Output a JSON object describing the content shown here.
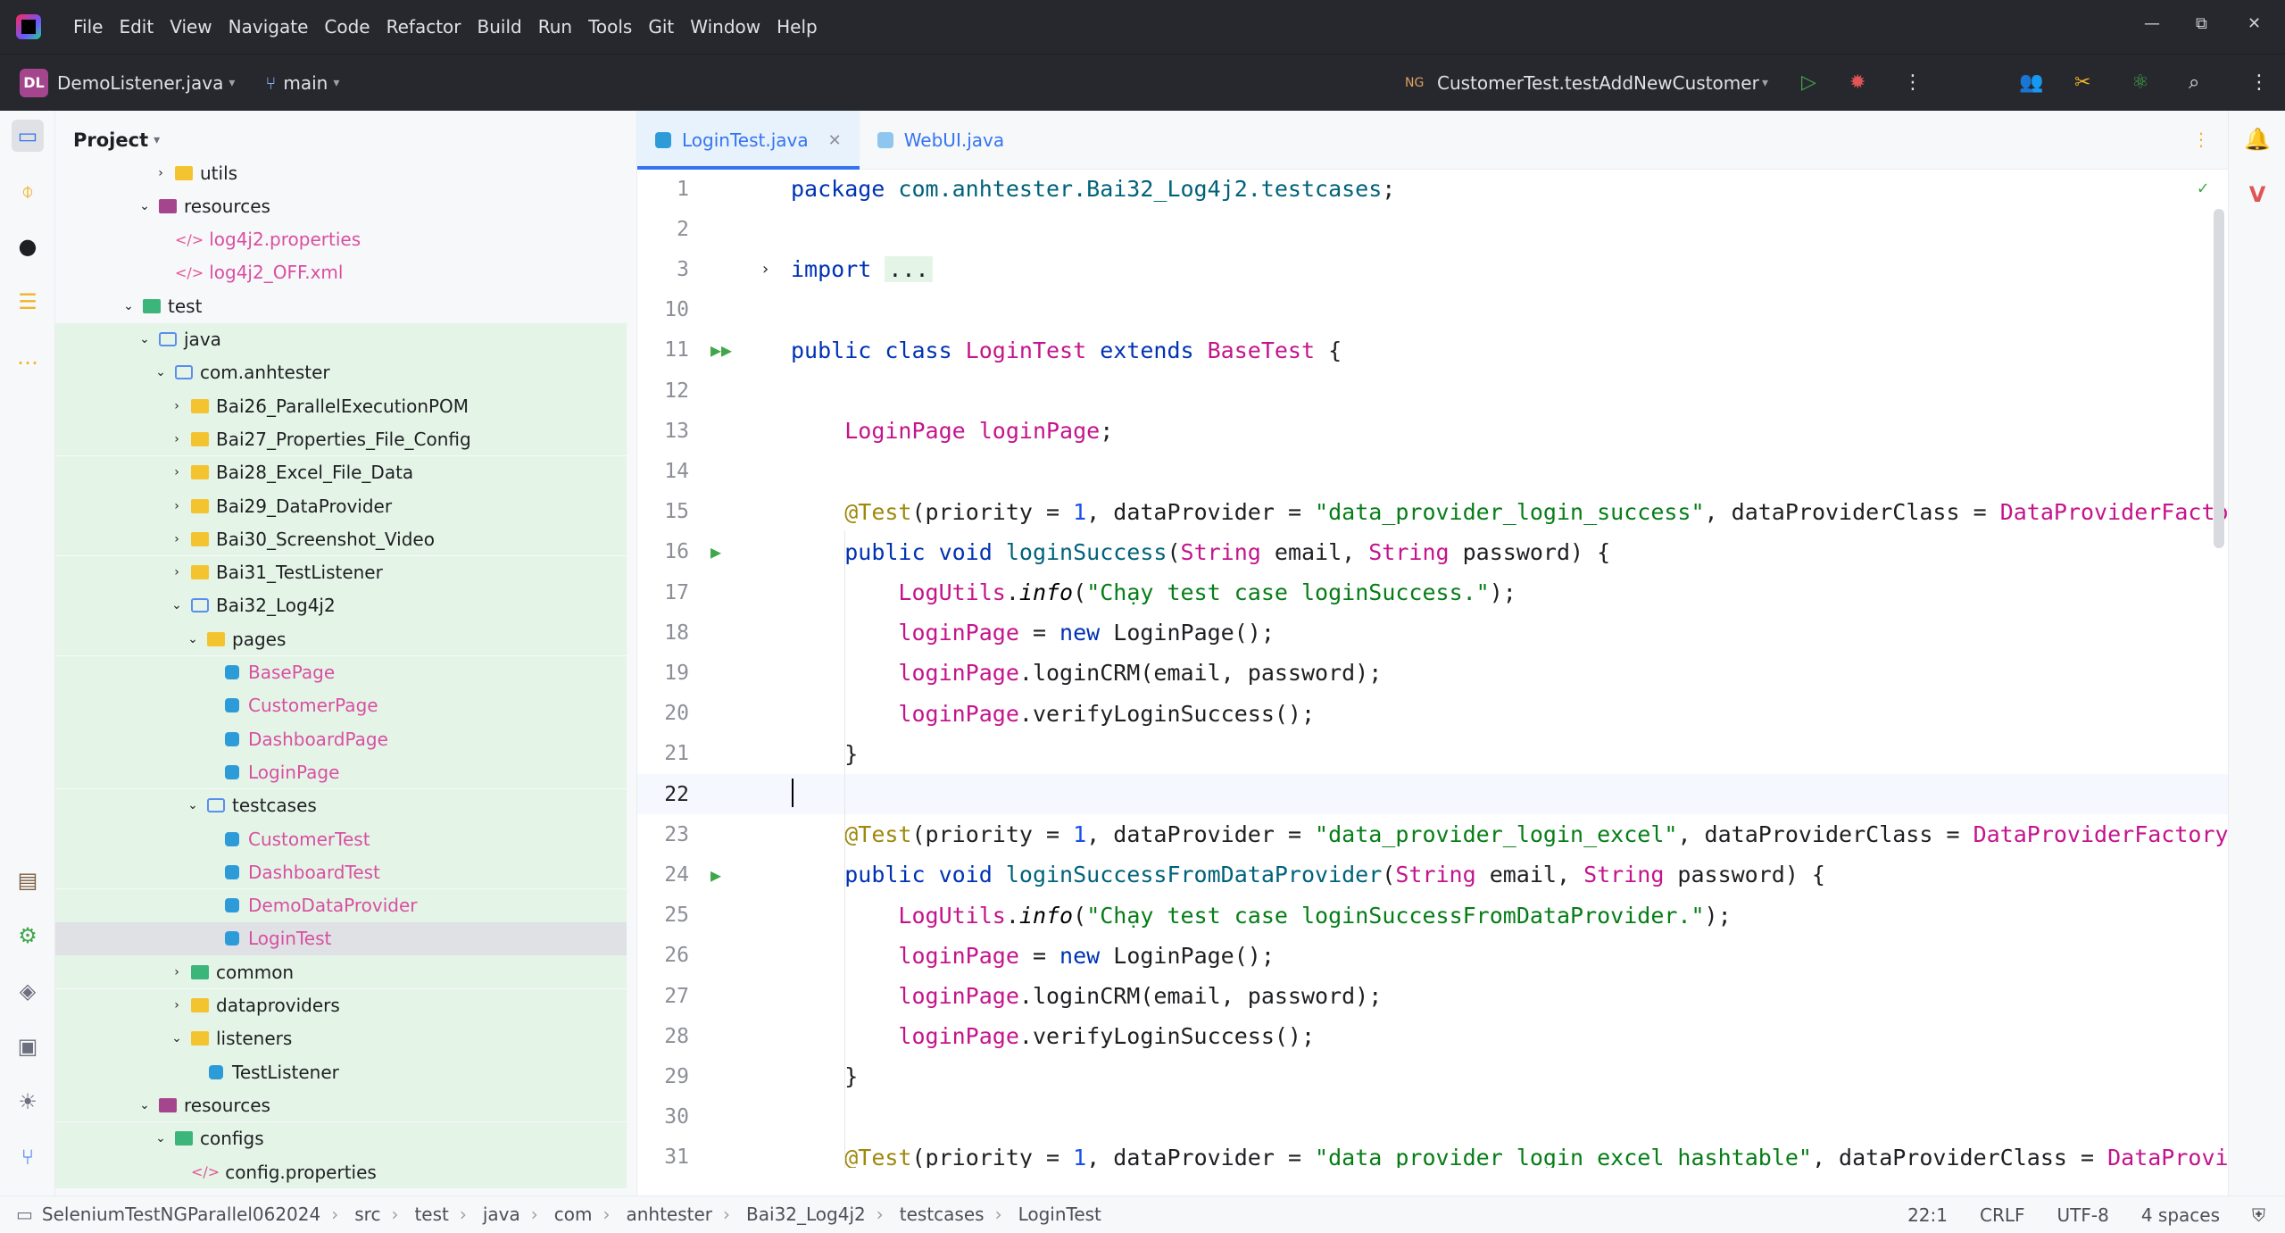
{
  "menubar": {
    "items": [
      "File",
      "Edit",
      "View",
      "Navigate",
      "Code",
      "Refactor",
      "Build",
      "Run",
      "Tools",
      "Git",
      "Window",
      "Help"
    ],
    "minimize_glyph": "—",
    "restore_glyph": "⧉",
    "close_glyph": "✕"
  },
  "toolbar": {
    "project_badge": "DL",
    "project_name": "DemoListener.java",
    "branch": "main",
    "run_config": "CustomerTest.testAddNewCustomer",
    "run_config_badge": "NG"
  },
  "project_panel": {
    "title": "Project",
    "tree": [
      {
        "label": "utils",
        "icon": "folder",
        "arrow": "›",
        "indent": 0,
        "color": "normal"
      },
      {
        "label": "resources",
        "icon": "res",
        "arrow": "⌄",
        "indent": -1,
        "color": "normal"
      },
      {
        "label": "log4j2.properties",
        "icon": "xml",
        "arrow": "",
        "indent": 0,
        "color": "pink"
      },
      {
        "label": "log4j2_OFF.xml",
        "icon": "xml",
        "arrow": "",
        "indent": 0,
        "color": "pink"
      },
      {
        "label": "test",
        "icon": "testfolder",
        "arrow": "⌄",
        "indent": -2,
        "color": "normal"
      },
      {
        "label": "java",
        "icon": "folder-o",
        "arrow": "⌄",
        "indent": -1,
        "color": "normal"
      },
      {
        "label": "com.anhtester",
        "icon": "folder-o",
        "arrow": "⌄",
        "indent": 0,
        "color": "normal"
      },
      {
        "label": "Bai26_ParallelExecutionPOM",
        "icon": "folder",
        "arrow": "›",
        "indent": 1,
        "color": "normal"
      },
      {
        "label": "Bai27_Properties_File_Config",
        "icon": "folder",
        "arrow": "›",
        "indent": 1,
        "color": "normal"
      },
      {
        "label": "Bai28_Excel_File_Data",
        "icon": "folder",
        "arrow": "›",
        "indent": 1,
        "color": "normal"
      },
      {
        "label": "Bai29_DataProvider",
        "icon": "folder",
        "arrow": "›",
        "indent": 1,
        "color": "normal"
      },
      {
        "label": "Bai30_Screenshot_Video",
        "icon": "folder",
        "arrow": "›",
        "indent": 1,
        "color": "normal"
      },
      {
        "label": "Bai31_TestListener",
        "icon": "folder",
        "arrow": "›",
        "indent": 1,
        "color": "normal"
      },
      {
        "label": "Bai32_Log4j2",
        "icon": "folder-o",
        "arrow": "⌄",
        "indent": 1,
        "color": "normal"
      },
      {
        "label": "pages",
        "icon": "folder",
        "arrow": "⌄",
        "indent": 2,
        "color": "normal"
      },
      {
        "label": "BasePage",
        "icon": "java",
        "arrow": "",
        "indent": 3,
        "color": "pink"
      },
      {
        "label": "CustomerPage",
        "icon": "java",
        "arrow": "",
        "indent": 3,
        "color": "pink"
      },
      {
        "label": "DashboardPage",
        "icon": "java",
        "arrow": "",
        "indent": 3,
        "color": "pink"
      },
      {
        "label": "LoginPage",
        "icon": "java",
        "arrow": "",
        "indent": 3,
        "color": "pink"
      },
      {
        "label": "testcases",
        "icon": "folder-o",
        "arrow": "⌄",
        "indent": 2,
        "color": "normal"
      },
      {
        "label": "CustomerTest",
        "icon": "java",
        "arrow": "",
        "indent": 3,
        "color": "pink"
      },
      {
        "label": "DashboardTest",
        "icon": "java",
        "arrow": "",
        "indent": 3,
        "color": "pink"
      },
      {
        "label": "DemoDataProvider",
        "icon": "java",
        "arrow": "",
        "indent": 3,
        "color": "pink"
      },
      {
        "label": "LoginTest",
        "icon": "java",
        "arrow": "",
        "indent": 3,
        "color": "pink"
      },
      {
        "label": "common",
        "icon": "testfolder",
        "arrow": "›",
        "indent": 1,
        "color": "normal"
      },
      {
        "label": "dataproviders",
        "icon": "folder",
        "arrow": "›",
        "indent": 1,
        "color": "normal"
      },
      {
        "label": "listeners",
        "icon": "folder",
        "arrow": "⌄",
        "indent": 1,
        "color": "normal"
      },
      {
        "label": "TestListener",
        "icon": "java",
        "arrow": "",
        "indent": 2,
        "color": "normal"
      },
      {
        "label": "resources",
        "icon": "res",
        "arrow": "⌄",
        "indent": -1,
        "color": "normal"
      },
      {
        "label": "configs",
        "icon": "testfolder",
        "arrow": "⌄",
        "indent": 0,
        "color": "normal"
      },
      {
        "label": "config.properties",
        "icon": "xml",
        "arrow": "",
        "indent": 1,
        "color": "normal"
      }
    ]
  },
  "tabs": [
    {
      "label": "LoginTest.java",
      "active": true
    },
    {
      "label": "WebUI.java",
      "active": false
    }
  ],
  "editor": {
    "lines": [
      {
        "n": "1",
        "tokens": [
          [
            "k",
            "package "
          ],
          [
            "m",
            "com.anhtester.Bai32_Log4j2.testcases"
          ],
          [
            "c",
            ";"
          ]
        ]
      },
      {
        "n": "2",
        "tokens": []
      },
      {
        "n": "3",
        "fold": true,
        "tokens": [
          [
            "k",
            "import "
          ],
          [
            "collapsed",
            "..."
          ]
        ]
      },
      {
        "n": "10",
        "tokens": []
      },
      {
        "n": "11",
        "gutter": "▶▶",
        "tokens": [
          [
            "k",
            "public class "
          ],
          [
            "f",
            "LoginTest "
          ],
          [
            "k",
            "extends "
          ],
          [
            "f",
            "BaseTest "
          ],
          [
            "c",
            "{"
          ]
        ]
      },
      {
        "n": "12",
        "tokens": []
      },
      {
        "n": "13",
        "tokens": [
          [
            "c",
            "    "
          ],
          [
            "f",
            "LoginPage "
          ],
          [
            "f",
            "loginPage"
          ],
          [
            "c",
            ";"
          ]
        ]
      },
      {
        "n": "14",
        "tokens": []
      },
      {
        "n": "15",
        "tokens": [
          [
            "c",
            "    "
          ],
          [
            "a",
            "@Test"
          ],
          [
            "c",
            "(priority = "
          ],
          [
            "n",
            "1"
          ],
          [
            "c",
            ", dataProvider = "
          ],
          [
            "s",
            "\"data_provider_login_success\""
          ],
          [
            "c",
            ", dataProviderClass = "
          ],
          [
            "f",
            "DataProviderFactory"
          ]
        ]
      },
      {
        "n": "16",
        "gutter": "▶",
        "tokens": [
          [
            "c",
            "    "
          ],
          [
            "k",
            "public void "
          ],
          [
            "m",
            "loginSuccess"
          ],
          [
            "c",
            "("
          ],
          [
            "f",
            "String "
          ],
          [
            "c",
            "email, "
          ],
          [
            "f",
            "String "
          ],
          [
            "c",
            "password) {"
          ]
        ]
      },
      {
        "n": "17",
        "tokens": [
          [
            "c",
            "        "
          ],
          [
            "f",
            "LogUtils"
          ],
          [
            "c",
            "."
          ],
          [
            "it",
            "info"
          ],
          [
            "c",
            "("
          ],
          [
            "s",
            "\"Chạy test case loginSuccess.\""
          ],
          [
            "c",
            ");"
          ]
        ]
      },
      {
        "n": "18",
        "tokens": [
          [
            "c",
            "        "
          ],
          [
            "f",
            "loginPage"
          ],
          [
            "c",
            " = "
          ],
          [
            "k",
            "new "
          ],
          [
            "c",
            "LoginPage();"
          ]
        ]
      },
      {
        "n": "19",
        "tokens": [
          [
            "c",
            "        "
          ],
          [
            "f",
            "loginPage"
          ],
          [
            "c",
            ".loginCRM(email, password);"
          ]
        ]
      },
      {
        "n": "20",
        "tokens": [
          [
            "c",
            "        "
          ],
          [
            "f",
            "loginPage"
          ],
          [
            "c",
            ".verifyLoginSuccess();"
          ]
        ]
      },
      {
        "n": "21",
        "tokens": [
          [
            "c",
            "    }"
          ]
        ]
      },
      {
        "n": "22",
        "cur": true,
        "tokens": []
      },
      {
        "n": "23",
        "tokens": [
          [
            "c",
            "    "
          ],
          [
            "a",
            "@Test"
          ],
          [
            "c",
            "(priority = "
          ],
          [
            "n",
            "1"
          ],
          [
            "c",
            ", dataProvider = "
          ],
          [
            "s",
            "\"data_provider_login_excel\""
          ],
          [
            "c",
            ", dataProviderClass = "
          ],
          [
            "f",
            "DataProviderFactory"
          ]
        ]
      },
      {
        "n": "24",
        "gutter": "▶",
        "tokens": [
          [
            "c",
            "    "
          ],
          [
            "k",
            "public void "
          ],
          [
            "m",
            "loginSuccessFromDataProvider"
          ],
          [
            "c",
            "("
          ],
          [
            "f",
            "String "
          ],
          [
            "c",
            "email, "
          ],
          [
            "f",
            "String "
          ],
          [
            "c",
            "password) {"
          ]
        ]
      },
      {
        "n": "25",
        "tokens": [
          [
            "c",
            "        "
          ],
          [
            "f",
            "LogUtils"
          ],
          [
            "c",
            "."
          ],
          [
            "it",
            "info"
          ],
          [
            "c",
            "("
          ],
          [
            "s",
            "\"Chạy test case loginSuccessFromDataProvider.\""
          ],
          [
            "c",
            ");"
          ]
        ]
      },
      {
        "n": "26",
        "tokens": [
          [
            "c",
            "        "
          ],
          [
            "f",
            "loginPage"
          ],
          [
            "c",
            " = "
          ],
          [
            "k",
            "new "
          ],
          [
            "c",
            "LoginPage();"
          ]
        ]
      },
      {
        "n": "27",
        "tokens": [
          [
            "c",
            "        "
          ],
          [
            "f",
            "loginPage"
          ],
          [
            "c",
            ".loginCRM(email, password);"
          ]
        ]
      },
      {
        "n": "28",
        "tokens": [
          [
            "c",
            "        "
          ],
          [
            "f",
            "loginPage"
          ],
          [
            "c",
            ".verifyLoginSuccess();"
          ]
        ]
      },
      {
        "n": "29",
        "tokens": [
          [
            "c",
            "    }"
          ]
        ]
      },
      {
        "n": "30",
        "tokens": []
      },
      {
        "n": "31",
        "tokens": [
          [
            "c",
            "    "
          ],
          [
            "a",
            "@Test"
          ],
          [
            "c",
            "(priority = "
          ],
          [
            "n",
            "1"
          ],
          [
            "c",
            ", dataProvider = "
          ],
          [
            "s",
            "\"data_provider_login_excel_hashtable\""
          ],
          [
            "c",
            ", dataProviderClass = "
          ],
          [
            "f",
            "DataProvider"
          ]
        ]
      }
    ]
  },
  "statusbar": {
    "breadcrumbs": [
      "SeleniumTestNGParallel062024",
      "src",
      "test",
      "java",
      "com",
      "anhtester",
      "Bai32_Log4j2",
      "testcases",
      "LoginTest"
    ],
    "position": "22:1",
    "line_ending": "CRLF",
    "encoding": "UTF-8",
    "indent": "4 spaces"
  },
  "colors": {
    "keyword": "#0033b3",
    "string": "#067d17",
    "annotation": "#9e880d",
    "field": "#c4148c",
    "accent": "#3574f0"
  }
}
